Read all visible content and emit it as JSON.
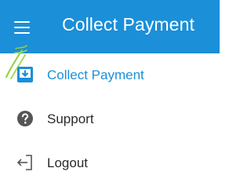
{
  "colors": {
    "primary": "#1b8fd8",
    "text": "#2a2a2a",
    "icon": "#555555",
    "gesture": "#8fcf3a"
  },
  "app_bar": {
    "title": "Collect Payment",
    "menu_icon": "hamburger-menu-icon"
  },
  "nav": {
    "items": [
      {
        "label": "Collect Payment",
        "icon": "download-box-icon",
        "active": true
      },
      {
        "label": "Support",
        "icon": "help-circle-icon",
        "active": false
      },
      {
        "label": "Logout",
        "icon": "logout-icon",
        "active": false
      }
    ]
  }
}
